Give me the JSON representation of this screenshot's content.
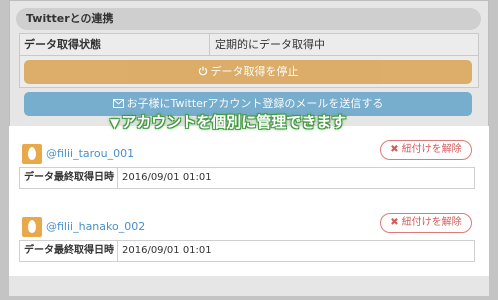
{
  "section": {
    "title": "Twitterとの連携"
  },
  "status": {
    "label": "データ取得状態",
    "value": "定期的にデータ取得中"
  },
  "buttons": {
    "stop_icon": "power-icon",
    "stop_label": "データ取得を停止",
    "mail_icon": "envelope-icon",
    "mail_label": "お子様にTwitterアカウント登録のメールを送信する"
  },
  "caption": {
    "arrow": "▼",
    "text": "アカウントを個別に管理できます"
  },
  "accounts": [
    {
      "name": "@filii_tarou_001",
      "unlink_label": "紐付けを解除",
      "last_fetch_label": "データ最終取得日時",
      "last_fetch_value": "2016/09/01 01:01"
    },
    {
      "name": "@filii_hanako_002",
      "unlink_label": "紐付けを解除",
      "last_fetch_label": "データ最終取得日時",
      "last_fetch_value": "2016/09/01 01:01"
    }
  ],
  "colors": {
    "stop_button": "#d9a352",
    "mail_button": "#5c9fc7",
    "caption_glow": "#4aa04a",
    "account_link": "#4a90c8",
    "unlink_border": "#e07a7a",
    "avatar_bg": "#e8a94a"
  }
}
